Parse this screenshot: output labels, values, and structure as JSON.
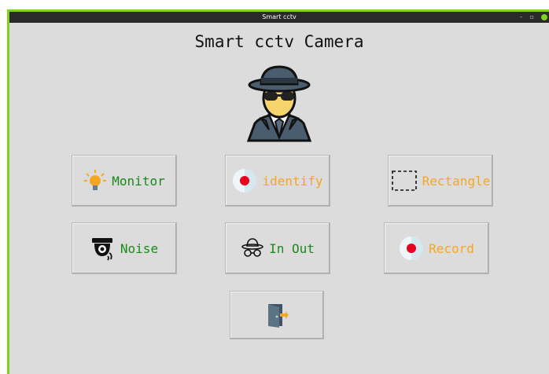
{
  "window": {
    "title": "Smart cctv",
    "controls": {
      "minimize": "–",
      "maximize": "▫"
    }
  },
  "app": {
    "heading": "Smart cctv Camera"
  },
  "buttons": {
    "monitor": {
      "label": "Monitor",
      "color": "#1a8a1a",
      "icon": "light-bulb-icon"
    },
    "identify": {
      "label": "identify",
      "color": "#f5a623",
      "icon": "record-dot-icon"
    },
    "rectangle": {
      "label": "Rectangle",
      "color": "#f5a623",
      "icon": "dashed-rectangle-icon"
    },
    "noise": {
      "label": "Noise",
      "color": "#1a8a1a",
      "icon": "security-camera-icon"
    },
    "inout": {
      "label": "In Out",
      "color": "#1a8a1a",
      "icon": "spy-glasses-icon"
    },
    "record": {
      "label": "Record",
      "color": "#f5a623",
      "icon": "record-dot-icon"
    },
    "exit": {
      "label": "",
      "icon": "exit-door-icon"
    }
  },
  "colors": {
    "accent_green": "#7ed321",
    "window_bg": "#dcdcdc"
  }
}
